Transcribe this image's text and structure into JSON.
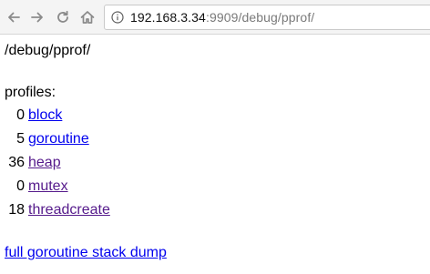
{
  "browser": {
    "url_host": "192.168.3.34",
    "url_rest": ":9909/debug/pprof/",
    "icons": {
      "back": "arrow-left",
      "forward": "arrow-right",
      "reload": "reload",
      "home": "home",
      "site_info": "info-circle"
    }
  },
  "page": {
    "title": "/debug/pprof/",
    "profiles_label": "profiles:",
    "profiles": [
      {
        "count": "0",
        "name": "block",
        "visited": false
      },
      {
        "count": "5",
        "name": "goroutine",
        "visited": false
      },
      {
        "count": "36",
        "name": "heap",
        "visited": true
      },
      {
        "count": "0",
        "name": "mutex",
        "visited": true
      },
      {
        "count": "18",
        "name": "threadcreate",
        "visited": true
      }
    ],
    "full_dump_label": "full goroutine stack dump"
  },
  "colors": {
    "link": "#0000ee",
    "visited_link": "#551a8b",
    "toolbar_bg": "#f4f4f4"
  }
}
